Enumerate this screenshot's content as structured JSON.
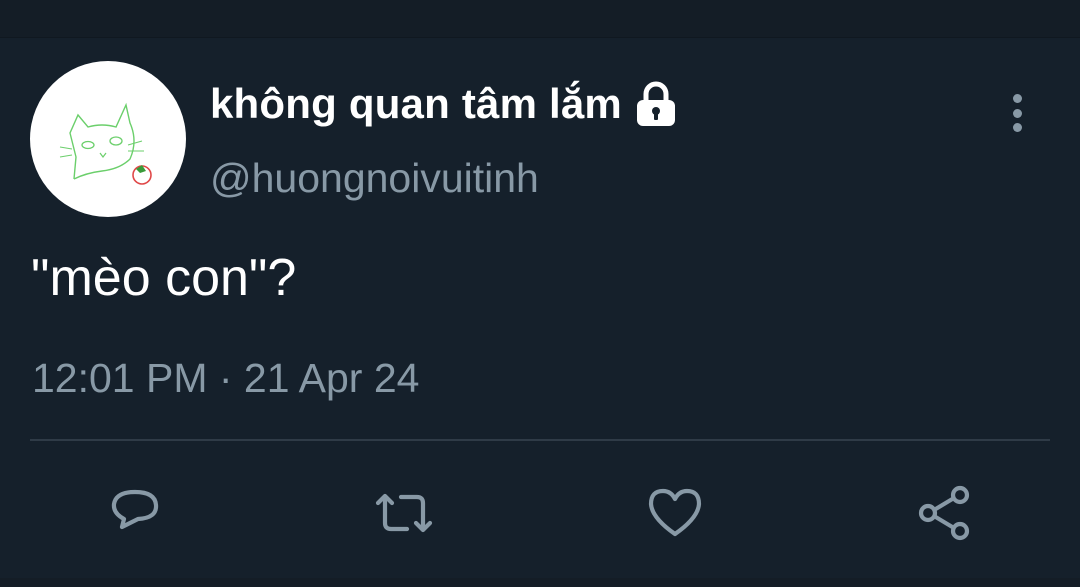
{
  "tweet": {
    "display_name": "không quan tâm lắm",
    "handle": "@huongnoivuitinh",
    "text": "\"mèo con\"?",
    "timestamp": "12:01 PM · 21 Apr 24",
    "protected": true
  },
  "icons": {
    "avatar": "cat-doodle-avatar",
    "protected": "lock-icon",
    "menu": "more-vertical-icon",
    "reply": "reply-icon",
    "retweet": "retweet-icon",
    "like": "heart-icon",
    "share": "share-icon"
  },
  "colors": {
    "background": "#15202b",
    "primary_text": "#ffffff",
    "secondary_text": "#8899a6",
    "divider": "#2f3b47"
  }
}
